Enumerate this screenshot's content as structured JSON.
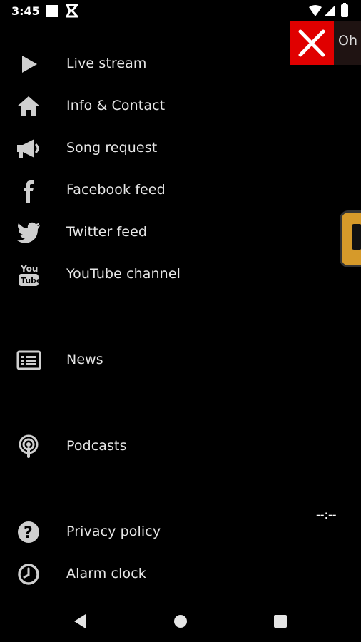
{
  "status_bar": {
    "time": "3:45"
  },
  "drawer": {
    "items": [
      {
        "label": "Live stream",
        "icon": "play-icon"
      },
      {
        "label": "Info & Contact",
        "icon": "home-icon"
      },
      {
        "label": "Song request",
        "icon": "megaphone-icon"
      },
      {
        "label": "Facebook feed",
        "icon": "facebook-icon"
      },
      {
        "label": "Twitter feed",
        "icon": "twitter-icon"
      },
      {
        "label": "YouTube channel",
        "icon": "youtube-icon"
      },
      {
        "label": "News",
        "icon": "news-icon"
      },
      {
        "label": "Podcasts",
        "icon": "podcast-icon"
      },
      {
        "label": "Privacy policy",
        "icon": "help-icon"
      },
      {
        "label": "Alarm clock",
        "icon": "clock-icon"
      }
    ]
  },
  "overlay": {
    "ad_text": "Oh S",
    "time_display": "--:--",
    "close_color": "#e00000",
    "logo_color": "#d69a2a"
  }
}
